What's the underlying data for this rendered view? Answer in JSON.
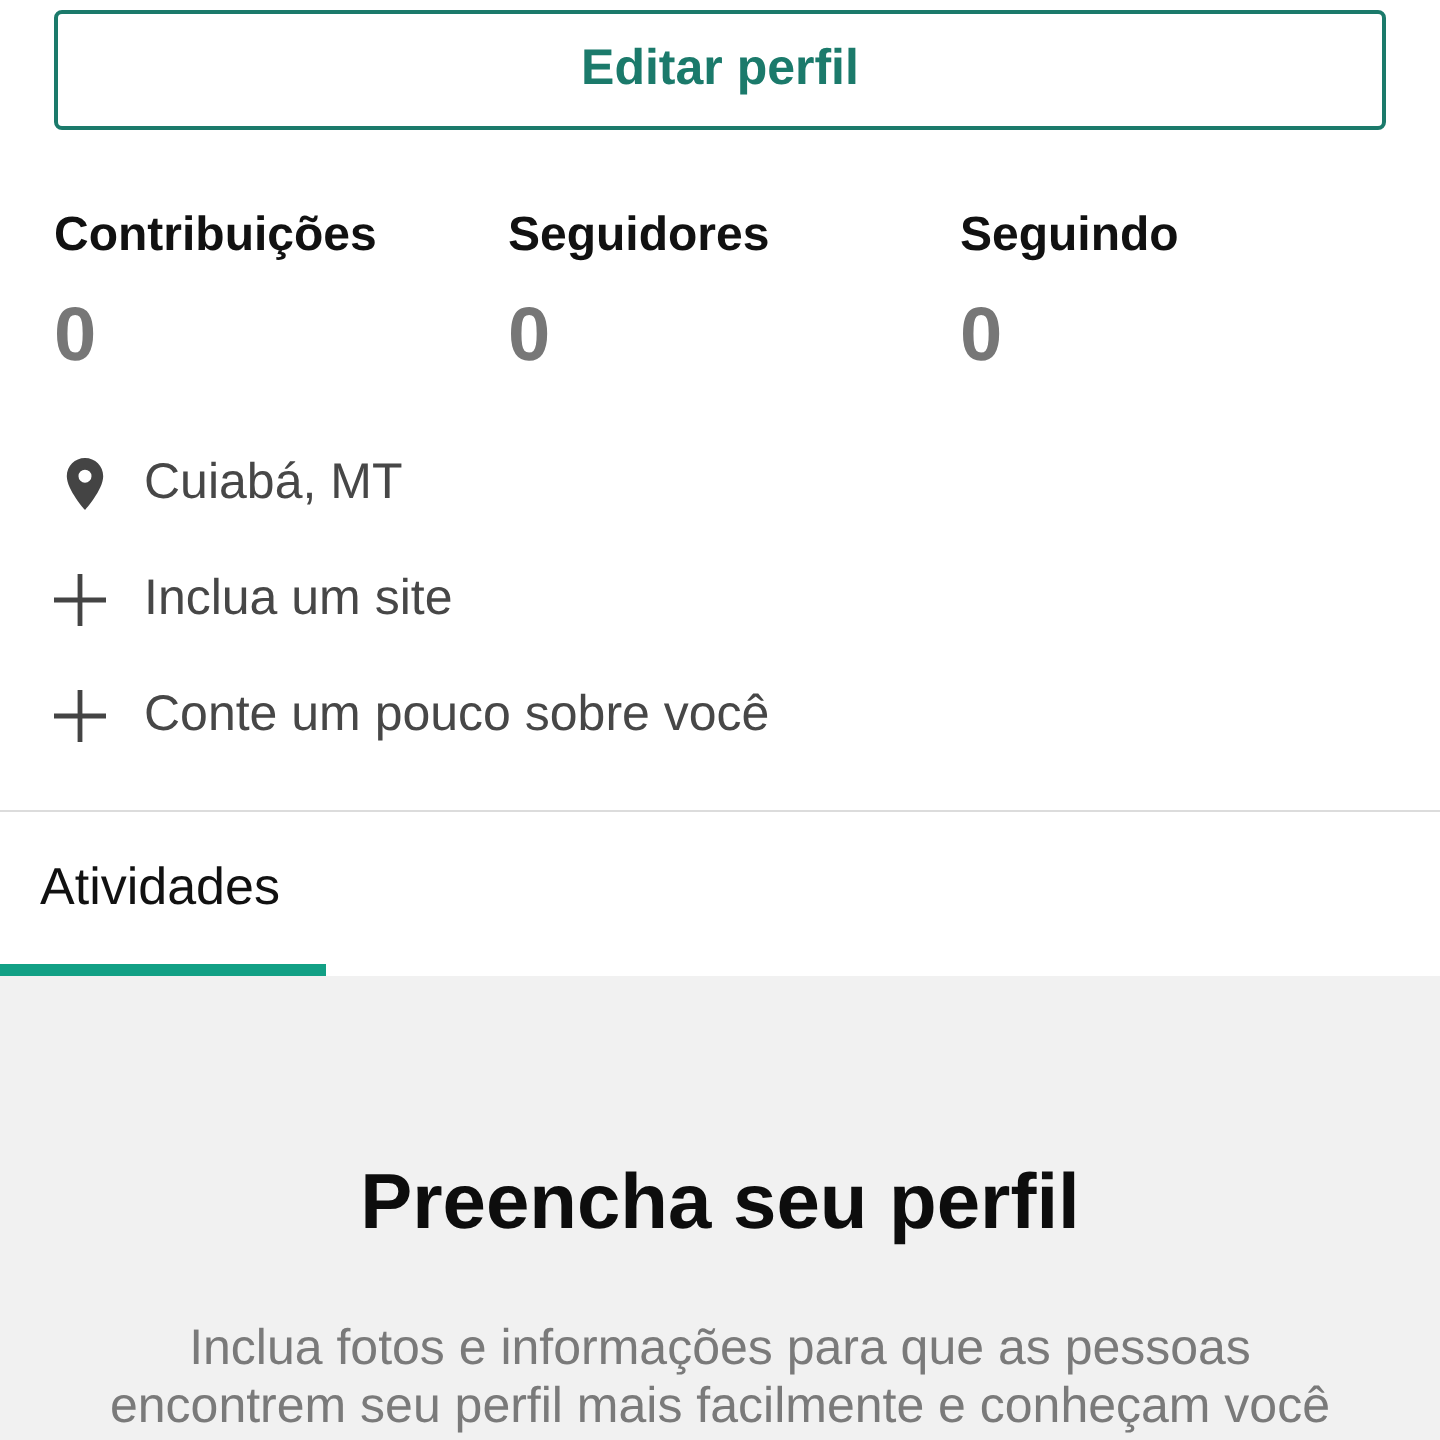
{
  "edit_button": {
    "label": "Editar perfil"
  },
  "stats": [
    {
      "label": "Contribuições",
      "value": "0"
    },
    {
      "label": "Seguidores",
      "value": "0"
    },
    {
      "label": "Seguindo",
      "value": "0"
    }
  ],
  "info_items": [
    {
      "kind": "location",
      "text": "Cuiabá, MT"
    },
    {
      "kind": "add",
      "text": "Inclua um site"
    },
    {
      "kind": "add",
      "text": "Conte um pouco sobre você"
    }
  ],
  "tabs": [
    {
      "label": "Atividades",
      "selected": true
    }
  ],
  "empty_state": {
    "title": "Preencha seu perfil",
    "description": "Inclua fotos e informações para que as pessoas encontrem seu perfil mais facilmente e conheçam você"
  }
}
